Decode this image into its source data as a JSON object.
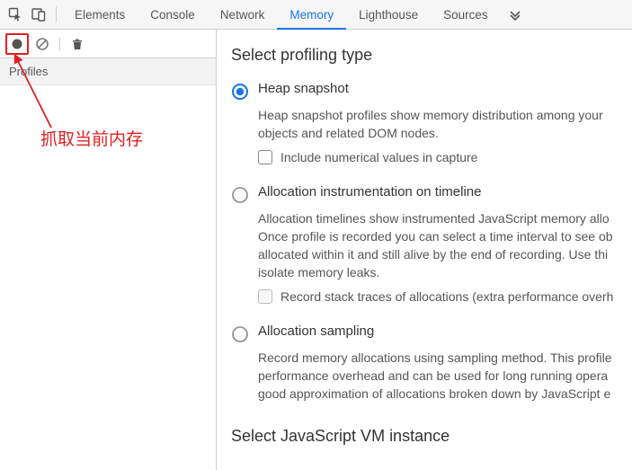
{
  "tabs": {
    "elements": "Elements",
    "console": "Console",
    "network": "Network",
    "memory": "Memory",
    "lighthouse": "Lighthouse",
    "sources": "Sources"
  },
  "sidebar": {
    "profiles": "Profiles"
  },
  "annotation": "抓取当前内存",
  "content": {
    "title1": "Select profiling type",
    "heap": {
      "label": "Heap snapshot",
      "desc": "Heap snapshot profiles show memory distribution among your objects and related DOM nodes.",
      "subcheck": "Include numerical values in capture"
    },
    "alloc_timeline": {
      "label": "Allocation instrumentation on timeline",
      "desc": "Allocation timelines show instrumented JavaScript memory allo Once profile is recorded you can select a time interval to see ob allocated within it and still alive by the end of recording. Use thi isolate memory leaks.",
      "subcheck": "Record stack traces of allocations (extra performance overh"
    },
    "alloc_sampling": {
      "label": "Allocation sampling",
      "desc": "Record memory allocations using sampling method. This profile performance overhead and can be used for long running opera good approximation of allocations broken down by JavaScript e"
    },
    "title2": "Select JavaScript VM instance"
  }
}
